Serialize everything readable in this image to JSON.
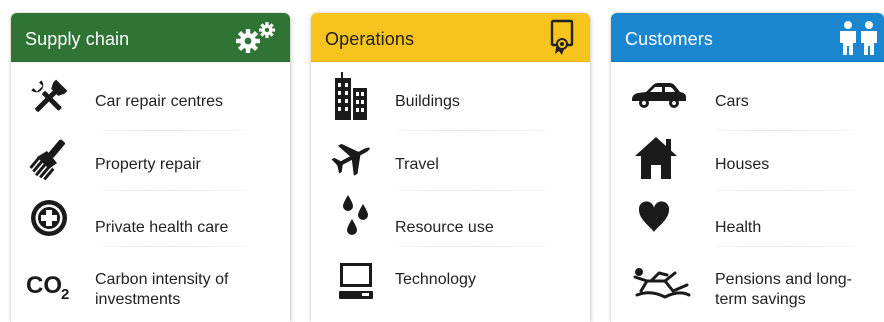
{
  "colors": {
    "supply_header": "#2f7434",
    "operations_header": "#f7c31d",
    "customers_header": "#1a86cf",
    "icon": "#1a1a1a"
  },
  "supply": {
    "title": "Supply chain",
    "header_icon": "gears-icon",
    "items": [
      {
        "label": "Car repair centres",
        "icon": "tools-icon"
      },
      {
        "label": "Property repair",
        "icon": "paintbrush-icon"
      },
      {
        "label": "Private health care",
        "icon": "medical-cross-icon"
      },
      {
        "label": "Carbon intensity of investments",
        "icon": "co2-icon",
        "icon_text": "CO2"
      }
    ]
  },
  "operations": {
    "title": "Operations",
    "header_icon": "certificate-icon",
    "items": [
      {
        "label": "Buildings",
        "icon": "buildings-icon"
      },
      {
        "label": "Travel",
        "icon": "airplane-icon"
      },
      {
        "label": "Resource use",
        "icon": "water-drops-icon"
      },
      {
        "label": "Technology",
        "icon": "computer-icon"
      }
    ]
  },
  "customers": {
    "title": "Customers",
    "header_icon": "people-icon",
    "items": [
      {
        "label": "Cars",
        "icon": "car-icon"
      },
      {
        "label": "Houses",
        "icon": "house-icon"
      },
      {
        "label": "Health",
        "icon": "heart-icon"
      },
      {
        "label": "Pensions and long-term savings",
        "icon": "reclining-person-icon"
      }
    ]
  }
}
